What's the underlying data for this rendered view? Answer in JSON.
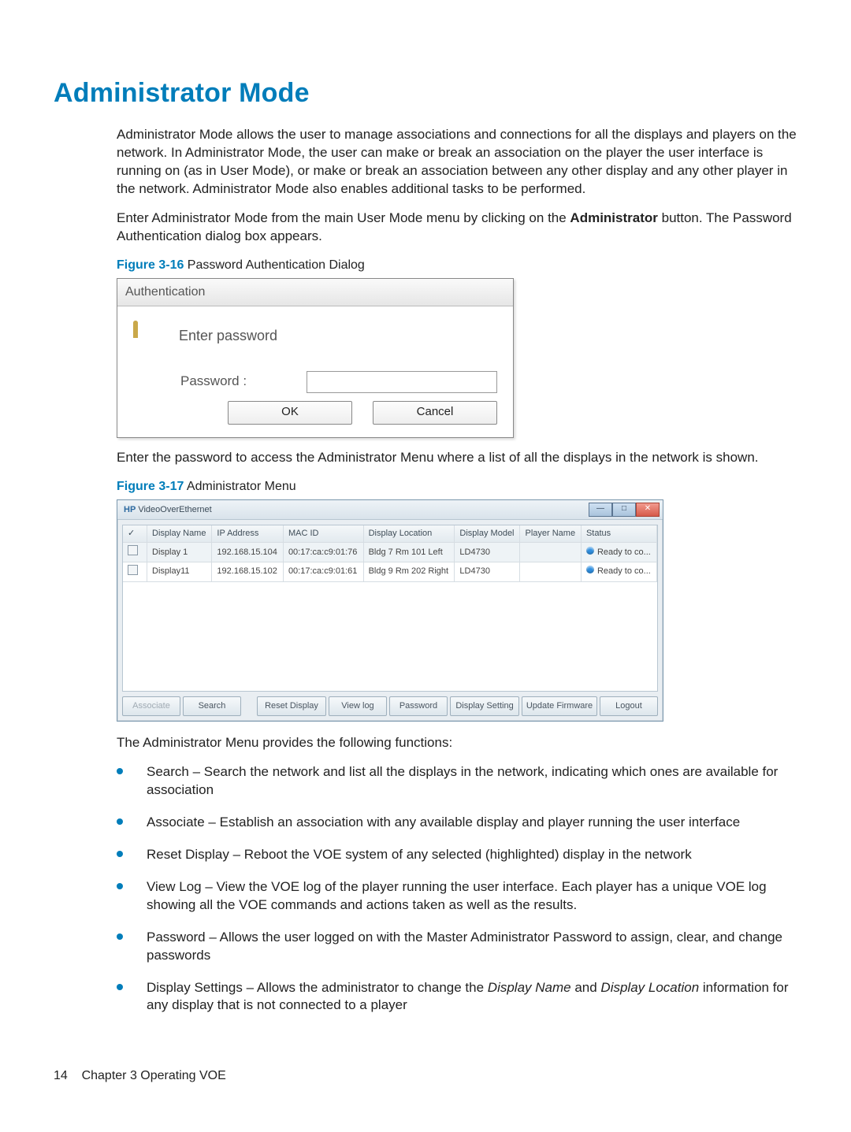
{
  "section_title": "Administrator Mode",
  "para1": "Administrator Mode allows the user to manage associations and connections for all the displays and players on the network. In Administrator Mode, the user can make or break an association on the player the user interface is running on (as in User Mode), or make or break an association between any other display and any other player in the network. Administrator Mode also enables additional tasks to be performed.",
  "para2_a": "Enter Administrator Mode from the main User Mode menu by clicking on the ",
  "para2_bold": "Administrator",
  "para2_b": " button. The Password Authentication dialog box appears.",
  "fig16_num": "Figure 3-16",
  "fig16_cap": "  Password Authentication Dialog",
  "auth": {
    "title": "Authentication",
    "enter": "Enter password",
    "plabel": "Password :",
    "ok": "OK",
    "cancel": "Cancel"
  },
  "para3": "Enter the password to access the Administrator Menu where a list of all the displays in the network is shown.",
  "fig17_num": "Figure 3-17",
  "fig17_cap": "  Administrator Menu",
  "admin": {
    "title_prefix": "HP",
    "title": "VideoOverEthernet",
    "headers": {
      "chk": "✓",
      "dn": "Display Name",
      "ip": "IP Address",
      "mac": "MAC ID",
      "loc": "Display Location",
      "model": "Display Model",
      "player": "Player Name",
      "status": "Status"
    },
    "rows": [
      {
        "dn": "Display 1",
        "ip": "192.168.15.104",
        "mac": "00:17:ca:c9:01:76",
        "loc": "Bldg 7 Rm 101 Left",
        "model": "LD4730",
        "player": "",
        "status": "Ready to co..."
      },
      {
        "dn": "Display11",
        "ip": "192.168.15.102",
        "mac": "00:17:ca:c9:01:61",
        "loc": "Bldg 9 Rm 202 Right",
        "model": "LD4730",
        "player": "",
        "status": "Ready to co..."
      }
    ],
    "buttons": {
      "associate": "Associate",
      "search": "Search",
      "reset": "Reset Display",
      "viewlog": "View log",
      "password": "Password",
      "dsetting": "Display Setting",
      "updatefw": "Update Firmware",
      "logout": "Logout"
    }
  },
  "para4": "The Administrator Menu provides the following functions:",
  "bullets": [
    "Search – Search the network and list all the displays in the network, indicating which ones are available for association",
    "Associate – Establish an association with any available display and player running the user interface",
    "Reset Display – Reboot the VOE system of any selected (highlighted) display in the network",
    "View Log – View the VOE log of the player running the user interface. Each player has a unique VOE log showing all the VOE commands and actions taken as well as the results.",
    "Password – Allows the user logged on with the Master Administrator Password to assign, clear, and change passwords"
  ],
  "bullet_ds_pre": "Display Settings – Allows the administrator to change the ",
  "bullet_ds_i1": "Display Name",
  "bullet_ds_mid": " and ",
  "bullet_ds_i2": "Display Location",
  "bullet_ds_post": " information for any display that is not connected to a player",
  "footer_page": "14",
  "footer_chapter": "Chapter 3   Operating VOE"
}
